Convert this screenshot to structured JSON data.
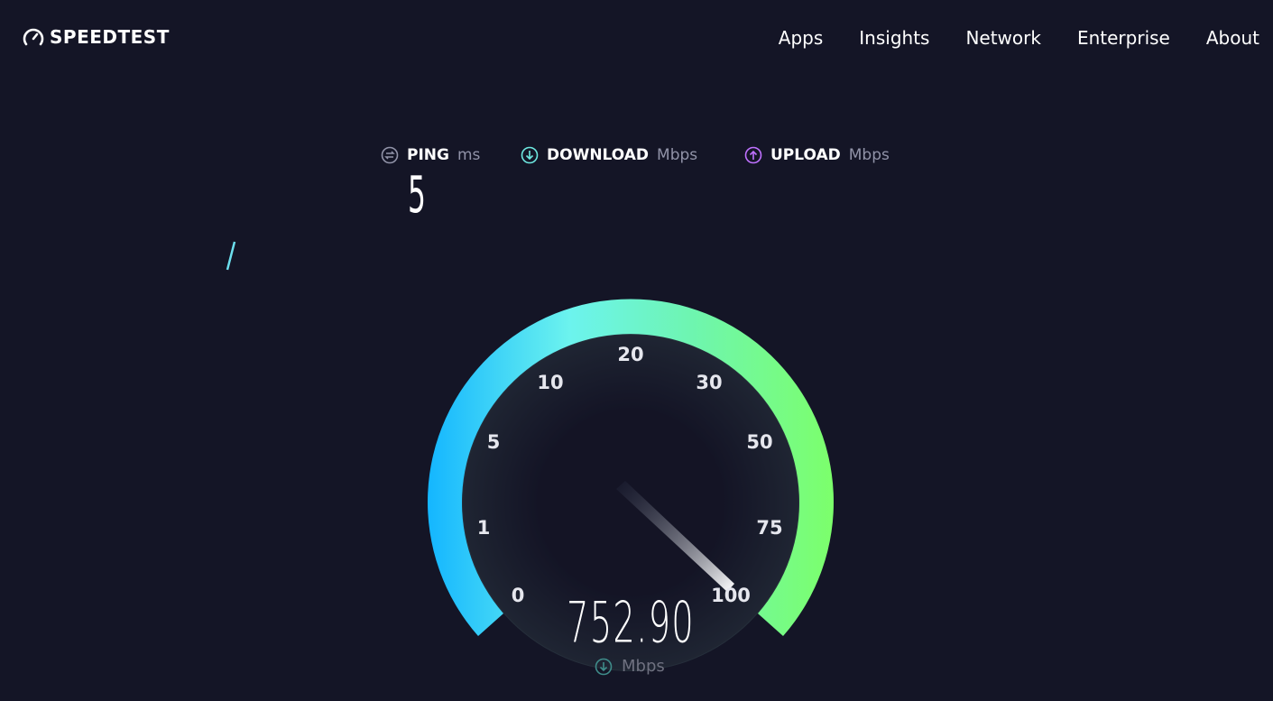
{
  "header": {
    "logo": "SPEEDTEST",
    "nav": [
      "Apps",
      "Insights",
      "Network",
      "Enterprise",
      "About"
    ]
  },
  "metrics": {
    "ping": {
      "label": "PING",
      "unit": "ms",
      "value": "5",
      "icon": "ping-icon",
      "color": "#9193a8"
    },
    "download": {
      "label": "DOWNLOAD",
      "unit": "Mbps",
      "icon": "download-icon",
      "color": "#6ee8e0"
    },
    "upload": {
      "label": "UPLOAD",
      "unit": "Mbps",
      "icon": "upload-icon",
      "color": "#bf71ff"
    }
  },
  "gauge": {
    "scale_labels": [
      "0",
      "1",
      "5",
      "10",
      "20",
      "30",
      "50",
      "75",
      "100"
    ],
    "reading": "752.90",
    "unit": "Mbps",
    "needle_at": "100",
    "gradient_start": "#14b6ff",
    "gradient_end": "#7cff6b"
  }
}
